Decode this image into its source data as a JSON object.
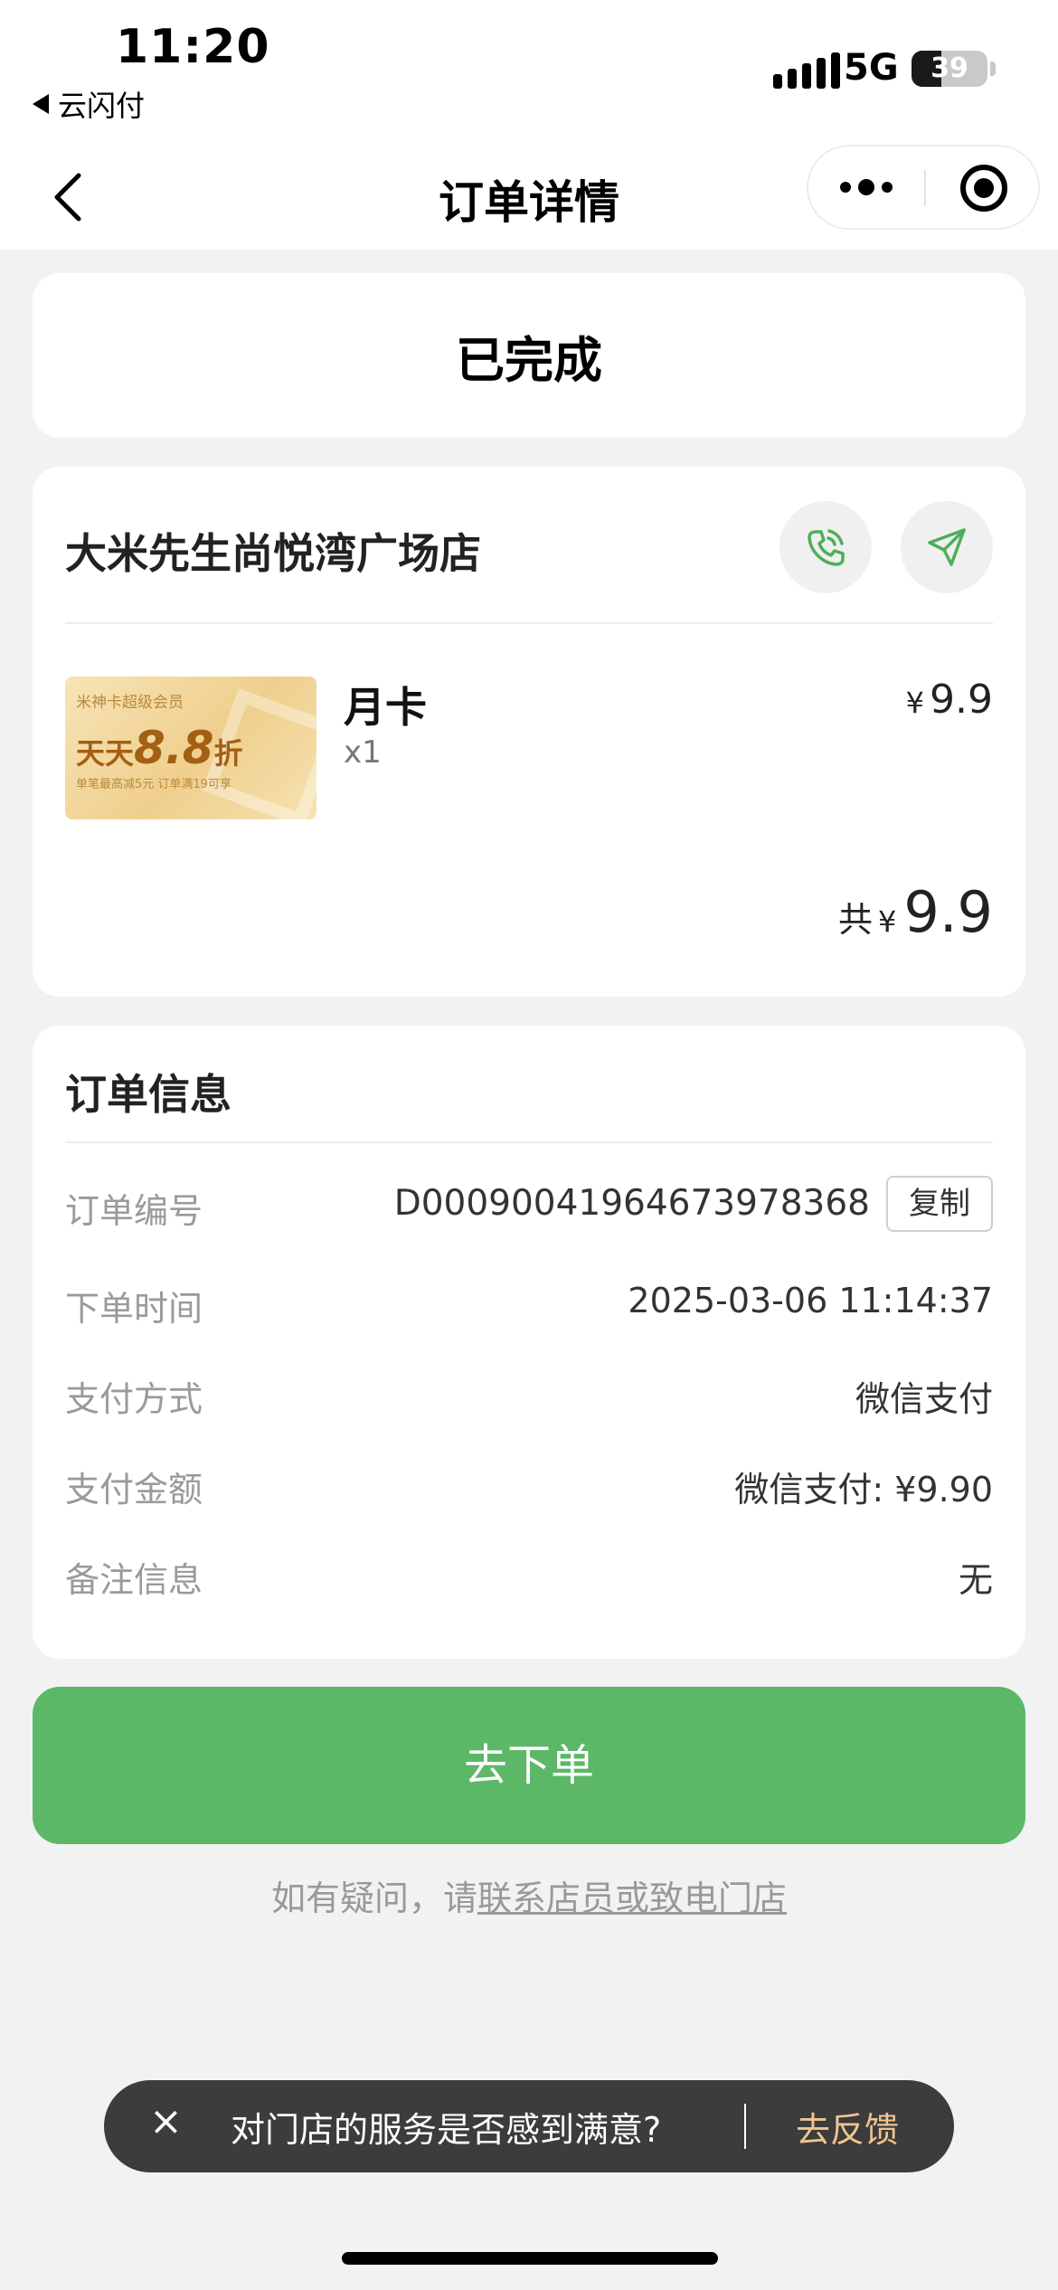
{
  "status_bar": {
    "time": "11:20",
    "back_app": "云闪付",
    "network": "5G",
    "battery": "39",
    "battery_level": 0.39
  },
  "nav": {
    "title": "订单详情",
    "more_icon": "more-dots-icon",
    "close_icon": "target-icon"
  },
  "order_status": "已完成",
  "store": {
    "name": "大米先生尚悦湾广场店",
    "phone_icon": "phone-icon",
    "nav_icon": "navigate-arrow-icon"
  },
  "product": {
    "image_text": {
      "line1": "米神卡超级会员",
      "line2_prefix": "天天",
      "line2_value": "8.8",
      "line2_suffix": "折",
      "line3": "单笔最高减5元 订单满19可享"
    },
    "name": "月卡",
    "qty": "x1",
    "currency": "¥",
    "price": "9.9"
  },
  "total": {
    "label": "共",
    "currency": "¥",
    "value": "9.9"
  },
  "info": {
    "title": "订单信息",
    "rows": [
      {
        "label": "订单编号",
        "value": "D0009004196467397836 8"
      },
      {
        "label": "下单时间",
        "value": "2025-03-06 11:14:37"
      },
      {
        "label": "支付方式",
        "value": "微信支付"
      },
      {
        "label": "支付金额",
        "value": "微信支付: ¥9.90"
      },
      {
        "label": "备注信息",
        "value": "无"
      }
    ],
    "copy_label": "复制"
  },
  "order_button": "去下单",
  "help": {
    "prefix": "如有疑问，请",
    "link": "联系店员或致电门店"
  },
  "toast": {
    "close": "×",
    "message": "对门店的服务是否感到满意?",
    "action": "去反馈"
  },
  "colors": {
    "accent_green": "#5cb866",
    "toast_action": "#f0c58e"
  }
}
